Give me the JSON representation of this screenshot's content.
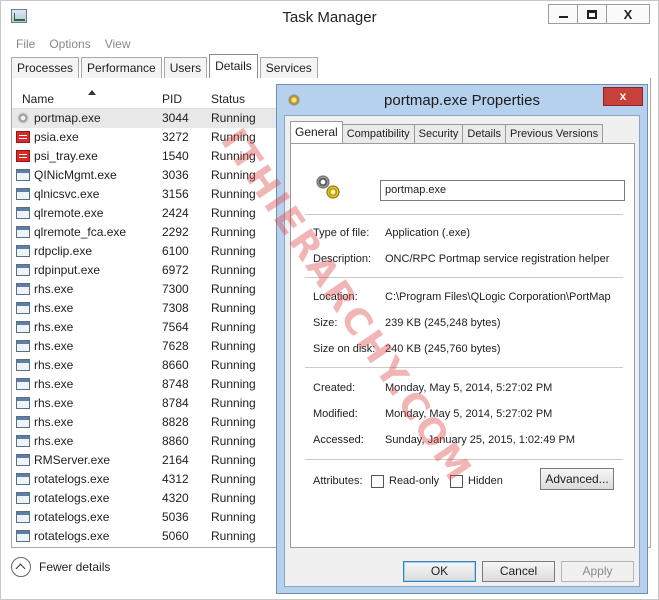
{
  "task_manager": {
    "title": "Task Manager",
    "window_buttons": {
      "minimize": "_",
      "maximize": "□",
      "close": "X"
    },
    "menu": [
      "File",
      "Options",
      "View"
    ],
    "tabs": [
      {
        "label": "Processes",
        "active": false
      },
      {
        "label": "Performance",
        "active": false
      },
      {
        "label": "Users",
        "active": false
      },
      {
        "label": "Details",
        "active": true
      },
      {
        "label": "Services",
        "active": false
      }
    ],
    "columns": {
      "name": "Name",
      "pid": "PID",
      "status": "Status"
    },
    "processes": [
      {
        "name": "portmap.exe",
        "pid": "3044",
        "status": "Running",
        "icon": "gear-icon",
        "selected": true
      },
      {
        "name": "psia.exe",
        "pid": "3272",
        "status": "Running",
        "icon": "red-app-icon"
      },
      {
        "name": "psi_tray.exe",
        "pid": "1540",
        "status": "Running",
        "icon": "red-app-icon"
      },
      {
        "name": "QINicMgmt.exe",
        "pid": "3036",
        "status": "Running",
        "icon": "window-app-icon"
      },
      {
        "name": "qlnicsvc.exe",
        "pid": "3156",
        "status": "Running",
        "icon": "window-app-icon"
      },
      {
        "name": "qlremote.exe",
        "pid": "2424",
        "status": "Running",
        "icon": "window-app-icon"
      },
      {
        "name": "qlremote_fca.exe",
        "pid": "2292",
        "status": "Running",
        "icon": "window-app-icon"
      },
      {
        "name": "rdpclip.exe",
        "pid": "6100",
        "status": "Running",
        "icon": "window-app-icon"
      },
      {
        "name": "rdpinput.exe",
        "pid": "6972",
        "status": "Running",
        "icon": "window-app-icon"
      },
      {
        "name": "rhs.exe",
        "pid": "7300",
        "status": "Running",
        "icon": "window-app-icon"
      },
      {
        "name": "rhs.exe",
        "pid": "7308",
        "status": "Running",
        "icon": "window-app-icon"
      },
      {
        "name": "rhs.exe",
        "pid": "7564",
        "status": "Running",
        "icon": "window-app-icon"
      },
      {
        "name": "rhs.exe",
        "pid": "7628",
        "status": "Running",
        "icon": "window-app-icon"
      },
      {
        "name": "rhs.exe",
        "pid": "8660",
        "status": "Running",
        "icon": "window-app-icon"
      },
      {
        "name": "rhs.exe",
        "pid": "8748",
        "status": "Running",
        "icon": "window-app-icon"
      },
      {
        "name": "rhs.exe",
        "pid": "8784",
        "status": "Running",
        "icon": "window-app-icon"
      },
      {
        "name": "rhs.exe",
        "pid": "8828",
        "status": "Running",
        "icon": "window-app-icon"
      },
      {
        "name": "rhs.exe",
        "pid": "8860",
        "status": "Running",
        "icon": "window-app-icon"
      },
      {
        "name": "RMServer.exe",
        "pid": "2164",
        "status": "Running",
        "icon": "window-app-icon"
      },
      {
        "name": "rotatelogs.exe",
        "pid": "4312",
        "status": "Running",
        "icon": "window-app-icon"
      },
      {
        "name": "rotatelogs.exe",
        "pid": "4320",
        "status": "Running",
        "icon": "window-app-icon"
      },
      {
        "name": "rotatelogs.exe",
        "pid": "5036",
        "status": "Running",
        "icon": "window-app-icon"
      },
      {
        "name": "rotatelogs.exe",
        "pid": "5060",
        "status": "Running",
        "icon": "window-app-icon"
      }
    ],
    "fewer_details": "Fewer details"
  },
  "properties": {
    "title": "portmap.exe Properties",
    "close": "x",
    "tabs": [
      {
        "label": "General",
        "active": true
      },
      {
        "label": "Compatibility",
        "active": false
      },
      {
        "label": "Security",
        "active": false
      },
      {
        "label": "Details",
        "active": false
      },
      {
        "label": "Previous Versions",
        "active": false
      }
    ],
    "file_name": "portmap.exe",
    "type_label": "Type of file:",
    "type_value": "Application (.exe)",
    "description_label": "Description:",
    "description_value": "ONC/RPC Portmap service registration helper",
    "location_label": "Location:",
    "location_value": "C:\\Program Files\\QLogic Corporation\\PortMap",
    "size_label": "Size:",
    "size_value": "239 KB (245,248 bytes)",
    "size_on_disk_label": "Size on disk:",
    "size_on_disk_value": "240 KB (245,760 bytes)",
    "created_label": "Created:",
    "created_value": "Monday, May 5, 2014, 5:27:02 PM",
    "modified_label": "Modified:",
    "modified_value": "Monday, May 5, 2014, 5:27:02 PM",
    "accessed_label": "Accessed:",
    "accessed_value": "Sunday, January 25, 2015, 1:02:49 PM",
    "attributes_label": "Attributes:",
    "readonly_label": "Read-only",
    "hidden_label": "Hidden",
    "advanced_button": "Advanced...",
    "ok_button": "OK",
    "cancel_button": "Cancel",
    "apply_button": "Apply"
  },
  "watermark": "ITHIERARCHY.COM",
  "colors": {
    "dialog_frame": "#b6d1ee",
    "close_red": "#c7403a",
    "watermark": "#dc4646"
  }
}
